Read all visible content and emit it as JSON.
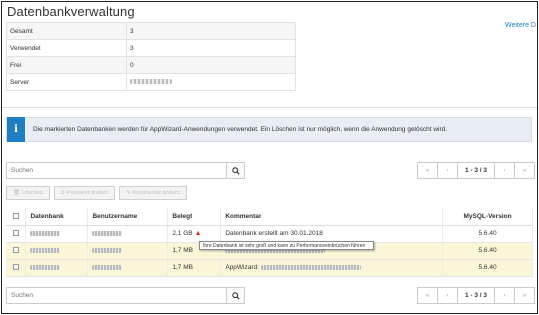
{
  "page": {
    "title": "Datenbankverwaltung",
    "weitere_link": "Weitere D"
  },
  "summary": [
    {
      "label": "Gesamt",
      "value": "3"
    },
    {
      "label": "Verwendet",
      "value": "3"
    },
    {
      "label": "Frei",
      "value": "0"
    },
    {
      "label": "Server",
      "value": ""
    }
  ],
  "alert": {
    "icon": "info-icon",
    "text": "Die markierten Datenbanken werden für AppWizard-Anwendungen verwendet. Ein Löschen ist nur möglich, wenn die Anwendung gelöscht wird."
  },
  "search_top": {
    "placeholder": "Suchen"
  },
  "search_bottom": {
    "placeholder": "Suchen"
  },
  "pager": {
    "first": "«",
    "prev": "‹",
    "count": "1 - 3 / 3",
    "next": "›",
    "last": "»"
  },
  "actions": {
    "delete": "Löschen",
    "reset_password": "Passwort ändern",
    "comment": "Kommentar ändern"
  },
  "table": {
    "headers": {
      "db": "Datenbank",
      "user": "Benutzername",
      "used": "Belegt",
      "comment": "Kommentar",
      "mysql": "MySQL-Version"
    },
    "rows": [
      {
        "used": "2,1 GB",
        "comment": "Datenbank erstellt am 30.01.2018",
        "mysql": "5.6.40",
        "warning": true
      },
      {
        "used": "1,7 MB",
        "comment": "",
        "mysql": "5.6.40",
        "warning": false
      },
      {
        "used": "1,7 MB",
        "comment": "AppWizard:",
        "mysql": "5.6.40",
        "warning": false
      }
    ]
  },
  "tooltip": "Ihre Datenbank ist sehr groß und kann zu Performanceeinbrüchen führen",
  "colors": {
    "accent": "#1f7fc0",
    "warn_row": "#fcf6d9",
    "warn_icon": "#d9342b"
  }
}
